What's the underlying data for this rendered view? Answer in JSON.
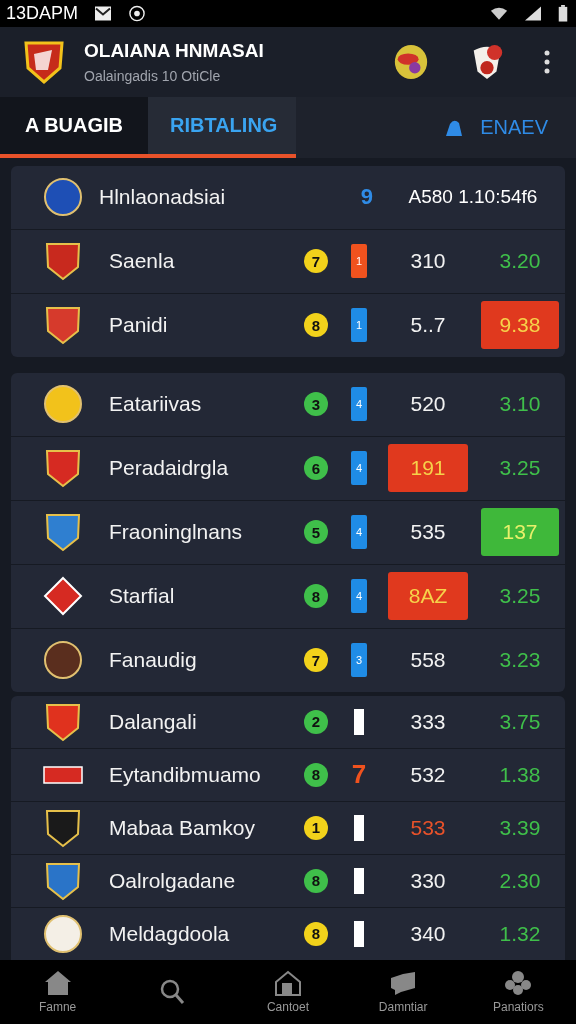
{
  "status_bar": {
    "time": "13DAPM"
  },
  "app_bar": {
    "title": "OLAIANA HNMASAI",
    "subtitle": "Oalaingadis 10 OtiCle"
  },
  "tabs": [
    {
      "label": "A BUAGIB",
      "selected": true
    },
    {
      "label": "RIBTALING",
      "selected": false
    }
  ],
  "action": {
    "label": "ENAEV"
  },
  "groups": [
    {
      "rows": [
        {
          "kind": "header",
          "crest": {
            "kind": "circle",
            "color": "#1e4fb5"
          },
          "name": "Hlnlaonadsiai",
          "badge": {
            "text": "9",
            "color": "#2f8be6"
          },
          "value": {
            "text": "A580 1.10:54f6",
            "kind": "plain"
          }
        },
        {
          "kind": "team",
          "crest": {
            "kind": "shield",
            "color": "#c8291e"
          },
          "name": "Saenla",
          "badge": {
            "text": "7",
            "color": "#f2d21b"
          },
          "marker": {
            "kind": "tag",
            "text": "1",
            "color": "#f0521e"
          },
          "value": {
            "text": "310",
            "kind": "plain"
          },
          "score": {
            "text": "3.20",
            "kind": "plain"
          }
        },
        {
          "kind": "team",
          "crest": {
            "kind": "shield",
            "color": "#d63a2c"
          },
          "name": "Panidi",
          "badge": {
            "text": "8",
            "color": "#f2d21b"
          },
          "marker": {
            "kind": "tag",
            "text": "1",
            "color": "#1f8ce6"
          },
          "value": {
            "text": "5..7",
            "kind": "plain"
          },
          "score": {
            "text": "9.38",
            "kind": "red_box"
          }
        }
      ]
    },
    {
      "rows": [
        {
          "kind": "team",
          "crest": {
            "kind": "circle",
            "color": "#f2c21b"
          },
          "name": "Eatariivas",
          "badge": {
            "text": "3",
            "color": "#3fbf4a"
          },
          "marker": {
            "kind": "tag",
            "text": "4",
            "color": "#1f8ce6"
          },
          "value": {
            "text": "520",
            "kind": "plain"
          },
          "score": {
            "text": "3.10",
            "kind": "plain"
          }
        },
        {
          "kind": "team",
          "crest": {
            "kind": "shield",
            "color": "#d62a22"
          },
          "name": "Peradaidrgla",
          "badge": {
            "text": "6",
            "color": "#3fbf4a"
          },
          "marker": {
            "kind": "tag",
            "text": "4",
            "color": "#1f8ce6"
          },
          "value": {
            "text": "191",
            "kind": "red_box"
          },
          "score": {
            "text": "3.25",
            "kind": "plain"
          }
        },
        {
          "kind": "team",
          "crest": {
            "kind": "shield",
            "color": "#2f7fd0"
          },
          "name": "Fraoninglnans",
          "badge": {
            "text": "5",
            "color": "#3fbf4a"
          },
          "marker": {
            "kind": "tag",
            "text": "4",
            "color": "#1f8ce6"
          },
          "value": {
            "text": "535",
            "kind": "plain"
          },
          "score": {
            "text": "137",
            "kind": "green_box"
          }
        },
        {
          "kind": "team",
          "crest": {
            "kind": "diamond",
            "color": "#d62a22"
          },
          "name": "Starfial",
          "badge": {
            "text": "8",
            "color": "#3fbf4a"
          },
          "marker": {
            "kind": "tag",
            "text": "4",
            "color": "#1f8ce6"
          },
          "value": {
            "text": "8AZ",
            "kind": "red_box"
          },
          "score": {
            "text": "3.25",
            "kind": "plain"
          }
        },
        {
          "kind": "team",
          "crest": {
            "kind": "circle",
            "color": "#5a2e1e"
          },
          "name": "Fanaudig",
          "badge": {
            "text": "7",
            "color": "#f2d21b"
          },
          "marker": {
            "kind": "tag",
            "text": "3",
            "color": "#1f8ce6"
          },
          "value": {
            "text": "558",
            "kind": "plain"
          },
          "score": {
            "text": "3.23",
            "kind": "plain"
          }
        }
      ]
    },
    {
      "rows": [
        {
          "kind": "team",
          "crest": {
            "kind": "shield",
            "color": "#e0321e"
          },
          "name": "Dalangali",
          "badge": {
            "text": "2",
            "color": "#3fbf4a"
          },
          "marker": {
            "kind": "bar"
          },
          "value": {
            "text": "333",
            "kind": "plain"
          },
          "score": {
            "text": "3.75",
            "kind": "plain"
          }
        },
        {
          "kind": "team",
          "crest": {
            "kind": "banner",
            "color": "#d62a22"
          },
          "name": "Eytandibmuamo",
          "badge": {
            "text": "8",
            "color": "#3fbf4a"
          },
          "marker": {
            "kind": "digit",
            "text": "7"
          },
          "value": {
            "text": "532",
            "kind": "plain"
          },
          "score": {
            "text": "1.38",
            "kind": "plain"
          }
        },
        {
          "kind": "team",
          "crest": {
            "kind": "shield",
            "color": "#1a1a1a"
          },
          "name": "Mabaa Bamkoy",
          "badge": {
            "text": "1",
            "color": "#f2d21b"
          },
          "marker": {
            "kind": "bar"
          },
          "value": {
            "text": "533",
            "kind": "red_text"
          },
          "score": {
            "text": "3.39",
            "kind": "plain"
          }
        },
        {
          "kind": "team",
          "crest": {
            "kind": "shield",
            "color": "#2a74c8"
          },
          "name": "Oalrolgadane",
          "badge": {
            "text": "8",
            "color": "#3fbf4a"
          },
          "marker": {
            "kind": "bar"
          },
          "value": {
            "text": "330",
            "kind": "plain"
          },
          "score": {
            "text": "2.30",
            "kind": "plain"
          }
        },
        {
          "kind": "team",
          "crest": {
            "kind": "circle",
            "color": "#f4efe6"
          },
          "name": "Meldagdoola",
          "badge": {
            "text": "8",
            "color": "#f2d21b"
          },
          "marker": {
            "kind": "bar"
          },
          "value": {
            "text": "340",
            "kind": "plain"
          },
          "score": {
            "text": "1.32",
            "kind": "plain"
          }
        }
      ]
    }
  ],
  "bottom_nav": [
    {
      "kind": "home",
      "label": "Famne"
    },
    {
      "kind": "search"
    },
    {
      "kind": "house",
      "label": "Cantoet"
    },
    {
      "kind": "chat",
      "label": "Damntiar"
    },
    {
      "kind": "paw",
      "label": "Panatiors"
    }
  ]
}
